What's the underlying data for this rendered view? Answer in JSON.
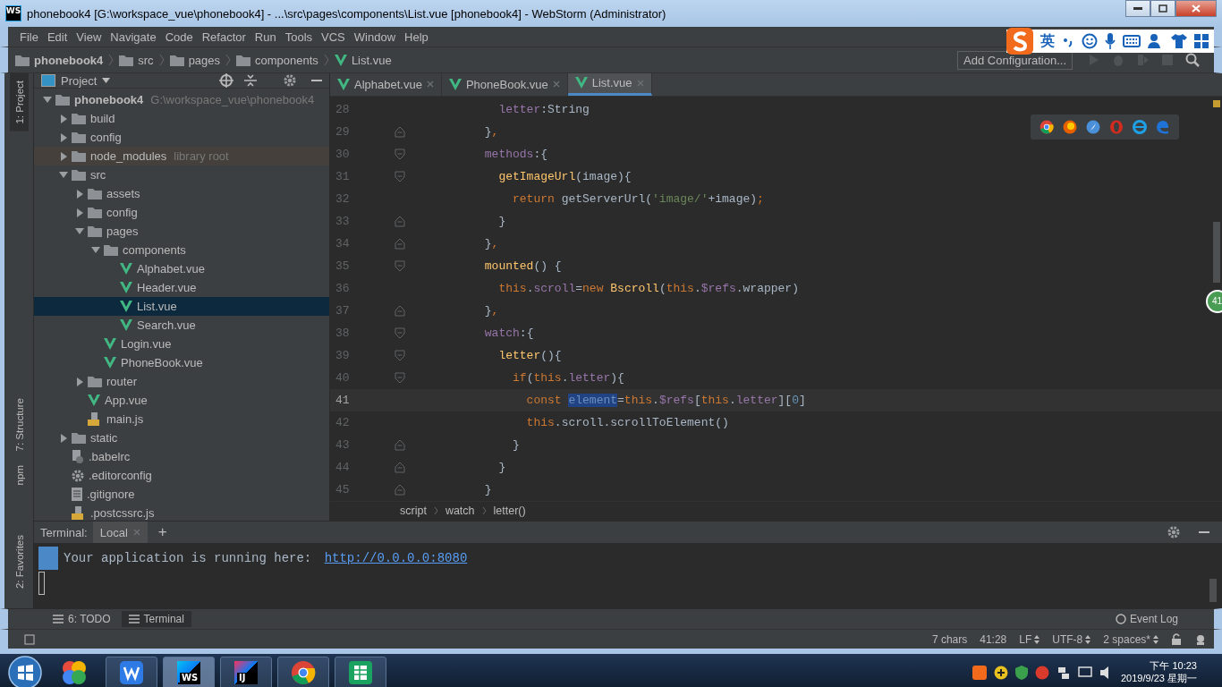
{
  "window": {
    "title": "phonebook4 [G:\\workspace_vue\\phonebook4] - ...\\src\\pages\\components\\List.vue [phonebook4] - WebStorm (Administrator)",
    "app_label": "WS"
  },
  "menu": [
    "File",
    "Edit",
    "View",
    "Navigate",
    "Code",
    "Refactor",
    "Run",
    "Tools",
    "VCS",
    "Window",
    "Help"
  ],
  "nav_path": [
    {
      "label": "phonebook4",
      "kind": "folder"
    },
    {
      "label": "src",
      "kind": "folder"
    },
    {
      "label": "pages",
      "kind": "folder"
    },
    {
      "label": "components",
      "kind": "folder"
    },
    {
      "label": "List.vue",
      "kind": "vue"
    }
  ],
  "add_configuration": "Add Configuration...",
  "ime_toolbar": {
    "label": "英"
  },
  "tool_strip": {
    "top": [
      {
        "label": "1: Project",
        "selected": true
      },
      {
        "label": "7: Structure",
        "selected": false
      },
      {
        "label": "npm",
        "selected": false
      }
    ],
    "bottom": [
      {
        "label": "2: Favorites",
        "selected": false
      }
    ]
  },
  "project": {
    "title": "Project",
    "tree": [
      {
        "label": "phonebook4",
        "hint": "G:\\workspace_vue\\phonebook4",
        "kind": "folder",
        "expanded": true,
        "selected": false,
        "children": [
          {
            "label": "build",
            "kind": "folder",
            "expanded": false,
            "selected": false
          },
          {
            "label": "config",
            "kind": "folder",
            "expanded": false,
            "selected": false
          },
          {
            "label": "node_modules",
            "hint": "library root",
            "kind": "library",
            "expanded": false,
            "selected": false
          },
          {
            "label": "src",
            "kind": "folder",
            "expanded": true,
            "selected": false,
            "children": [
              {
                "label": "assets",
                "kind": "folder",
                "expanded": false,
                "selected": false
              },
              {
                "label": "config",
                "kind": "folder",
                "expanded": false,
                "selected": false
              },
              {
                "label": "pages",
                "kind": "folder",
                "expanded": true,
                "selected": false,
                "children": [
                  {
                    "label": "components",
                    "kind": "folder",
                    "expanded": true,
                    "selected": false,
                    "children": [
                      {
                        "label": "Alphabet.vue",
                        "kind": "vue",
                        "selected": false
                      },
                      {
                        "label": "Header.vue",
                        "kind": "vue",
                        "selected": false
                      },
                      {
                        "label": "List.vue",
                        "kind": "vue",
                        "selected": true
                      },
                      {
                        "label": "Search.vue",
                        "kind": "vue",
                        "selected": false
                      }
                    ]
                  },
                  {
                    "label": "Login.vue",
                    "kind": "vue",
                    "selected": false
                  },
                  {
                    "label": "PhoneBook.vue",
                    "kind": "vue",
                    "selected": false
                  }
                ]
              },
              {
                "label": "router",
                "kind": "folder",
                "expanded": false,
                "selected": false
              },
              {
                "label": "App.vue",
                "kind": "vue",
                "selected": false
              },
              {
                "label": "main.js",
                "kind": "js",
                "selected": false
              }
            ]
          },
          {
            "label": "static",
            "kind": "folder",
            "expanded": false,
            "selected": false
          },
          {
            "label": ".babelrc",
            "kind": "config",
            "selected": false
          },
          {
            "label": ".editorconfig",
            "kind": "settings",
            "selected": false
          },
          {
            "label": ".gitignore",
            "kind": "text",
            "selected": false
          },
          {
            "label": ".postcssrc.js",
            "kind": "js",
            "selected": false
          }
        ]
      }
    ]
  },
  "editor": {
    "tabs": [
      {
        "label": "Alphabet.vue",
        "selected": false
      },
      {
        "label": "PhoneBook.vue",
        "selected": false
      },
      {
        "label": "List.vue",
        "selected": true
      }
    ],
    "lines": [
      {
        "number": "28",
        "current": false,
        "kind": "plain",
        "tokens": [
          {
            "kind": "key",
            "text": "        letter"
          },
          {
            "kind": "plain",
            "text": ":String"
          }
        ]
      },
      {
        "number": "29",
        "current": false,
        "kind": "fold-end",
        "tokens": [
          {
            "kind": "plain",
            "text": "      }"
          },
          {
            "kind": "kw",
            "text": ","
          }
        ]
      },
      {
        "number": "30",
        "current": false,
        "kind": "fold-start",
        "tokens": [
          {
            "kind": "key",
            "text": "      methods"
          },
          {
            "kind": "plain",
            "text": ":{"
          }
        ]
      },
      {
        "number": "31",
        "current": false,
        "kind": "fold-start",
        "tokens": [
          {
            "kind": "fn",
            "text": "        getImageUrl"
          },
          {
            "kind": "plain",
            "text": "(image){"
          }
        ]
      },
      {
        "number": "32",
        "current": false,
        "kind": "plain",
        "tokens": [
          {
            "kind": "kw",
            "text": "          return "
          },
          {
            "kind": "plain",
            "text": "getServerUrl("
          },
          {
            "kind": "str",
            "text": "'image/'"
          },
          {
            "kind": "plain",
            "text": "+image)"
          },
          {
            "kind": "kw",
            "text": ";"
          }
        ]
      },
      {
        "number": "33",
        "current": false,
        "kind": "fold-end",
        "tokens": [
          {
            "kind": "plain",
            "text": "        }"
          }
        ]
      },
      {
        "number": "34",
        "current": false,
        "kind": "fold-end",
        "tokens": [
          {
            "kind": "plain",
            "text": "      }"
          },
          {
            "kind": "kw",
            "text": ","
          }
        ]
      },
      {
        "number": "35",
        "current": false,
        "kind": "fold-start",
        "tokens": [
          {
            "kind": "fn",
            "text": "      mounted"
          },
          {
            "kind": "plain",
            "text": "() {"
          }
        ]
      },
      {
        "number": "36",
        "current": false,
        "kind": "plain",
        "tokens": [
          {
            "kind": "kw",
            "text": "        this"
          },
          {
            "kind": "plain",
            "text": "."
          },
          {
            "kind": "key",
            "text": "scroll"
          },
          {
            "kind": "plain",
            "text": "="
          },
          {
            "kind": "kw",
            "text": "new "
          },
          {
            "kind": "fn",
            "text": "Bscroll"
          },
          {
            "kind": "plain",
            "text": "("
          },
          {
            "kind": "kw",
            "text": "this"
          },
          {
            "kind": "plain",
            "text": "."
          },
          {
            "kind": "key",
            "text": "$refs"
          },
          {
            "kind": "plain",
            "text": ".wrapper)"
          }
        ]
      },
      {
        "number": "37",
        "current": false,
        "kind": "fold-end",
        "tokens": [
          {
            "kind": "plain",
            "text": "      }"
          },
          {
            "kind": "kw",
            "text": ","
          }
        ]
      },
      {
        "number": "38",
        "current": false,
        "kind": "fold-start",
        "tokens": [
          {
            "kind": "key",
            "text": "      watch"
          },
          {
            "kind": "plain",
            "text": ":{"
          }
        ]
      },
      {
        "number": "39",
        "current": false,
        "kind": "fold-start",
        "tokens": [
          {
            "kind": "fn",
            "text": "        letter"
          },
          {
            "kind": "plain",
            "text": "(){"
          }
        ]
      },
      {
        "number": "40",
        "current": false,
        "kind": "fold-start",
        "tokens": [
          {
            "kind": "kw",
            "text": "          if"
          },
          {
            "kind": "plain",
            "text": "("
          },
          {
            "kind": "kw",
            "text": "this"
          },
          {
            "kind": "plain",
            "text": "."
          },
          {
            "kind": "key",
            "text": "letter"
          },
          {
            "kind": "plain",
            "text": "){"
          }
        ]
      },
      {
        "number": "41",
        "current": true,
        "kind": "plain",
        "tokens": [
          {
            "kind": "kw",
            "text": "            const "
          },
          {
            "kind": "selection",
            "text": "element"
          },
          {
            "kind": "plain",
            "text": "="
          },
          {
            "kind": "kw",
            "text": "this"
          },
          {
            "kind": "plain",
            "text": "."
          },
          {
            "kind": "key",
            "text": "$refs"
          },
          {
            "kind": "plain",
            "text": "["
          },
          {
            "kind": "kw",
            "text": "this"
          },
          {
            "kind": "plain",
            "text": "."
          },
          {
            "kind": "key",
            "text": "letter"
          },
          {
            "kind": "plain",
            "text": "]["
          },
          {
            "kind": "num",
            "text": "0"
          },
          {
            "kind": "plain",
            "text": "]"
          }
        ]
      },
      {
        "number": "42",
        "current": false,
        "kind": "plain",
        "tokens": [
          {
            "kind": "kw",
            "text": "            this"
          },
          {
            "kind": "plain",
            "text": ".scroll.scrollToElement()"
          }
        ]
      },
      {
        "number": "43",
        "current": false,
        "kind": "fold-end",
        "tokens": [
          {
            "kind": "plain",
            "text": "          }"
          }
        ]
      },
      {
        "number": "44",
        "current": false,
        "kind": "fold-end",
        "tokens": [
          {
            "kind": "plain",
            "text": "        }"
          }
        ]
      },
      {
        "number": "45",
        "current": false,
        "kind": "fold-end",
        "tokens": [
          {
            "kind": "plain",
            "text": "      }"
          }
        ]
      }
    ],
    "breadcrumb": [
      "script",
      "watch",
      "letter()"
    ],
    "side_badge": "41"
  },
  "terminal": {
    "title": "Terminal:",
    "tabs": [
      {
        "label": "Local",
        "selected": true
      }
    ],
    "add": "+",
    "output": [
      {
        "text": "Your application is running here: ",
        "link": "http://0.0.0.0:8080"
      }
    ]
  },
  "tool_tabs": [
    {
      "label": "6: TODO",
      "selected": false
    },
    {
      "label": "Terminal",
      "selected": true
    }
  ],
  "event_log": "Event Log",
  "status": [
    {
      "text": "7 chars",
      "kind": "plain"
    },
    {
      "text": "41:28",
      "kind": "plain"
    },
    {
      "text": "LF",
      "kind": "dropdown"
    },
    {
      "text": "UTF-8",
      "kind": "dropdown"
    },
    {
      "text": "2 spaces*",
      "kind": "dropdown"
    }
  ],
  "taskbar": {
    "apps": [
      {
        "kind": "pinwheel",
        "running": false,
        "selected": false
      },
      {
        "kind": "wps",
        "running": true,
        "selected": false
      },
      {
        "kind": "webstorm",
        "label": "WS",
        "running": true,
        "selected": true
      },
      {
        "kind": "intellij",
        "label": "IJ",
        "running": true,
        "selected": false
      },
      {
        "kind": "chrome",
        "running": true,
        "selected": false
      },
      {
        "kind": "sheet",
        "running": true,
        "selected": false
      }
    ],
    "clock": {
      "time": "下午 10:23",
      "date": "2019/9/23 星期一"
    }
  }
}
